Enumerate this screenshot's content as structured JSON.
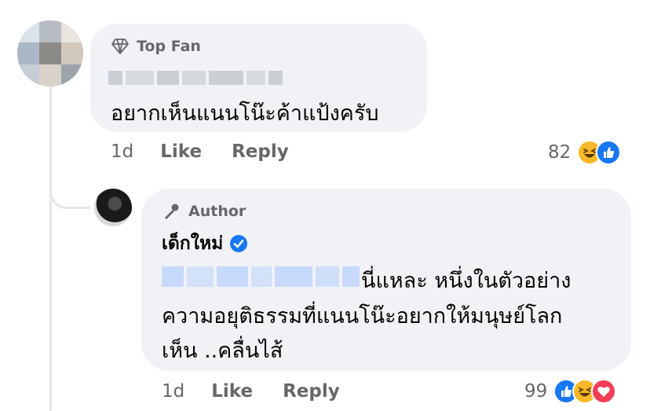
{
  "comment": {
    "badge": "Top Fan",
    "author_name_visible": false,
    "text": "อยากเห็นแนนโน๊ะค้าแป้งครับ",
    "time": "1d",
    "like_label": "Like",
    "reply_label": "Reply",
    "reaction_count": "82",
    "reactions": [
      "haha-icon",
      "like-icon"
    ]
  },
  "reply": {
    "badge": "Author",
    "author_name": "เด็กใหม่",
    "verified": true,
    "text_line1": "นี่แหละ หนึ่งในตัวอย่าง",
    "text_line2": "ความอยุติธรรมที่แนนโน๊ะอยากให้มนุษย์โลก",
    "text_line3": "เห็น ..คลื่นไส้",
    "time": "1d",
    "like_label": "Like",
    "reply_label": "Reply",
    "reaction_count": "99",
    "reactions": [
      "like-icon",
      "haha-icon",
      "love-icon"
    ]
  },
  "colors": {
    "bubble": "#f0f2f5",
    "secondary_text": "#65676b",
    "like_blue": "#1877f2",
    "haha_yellow": "#f7b928",
    "love_red": "#f33e58"
  }
}
